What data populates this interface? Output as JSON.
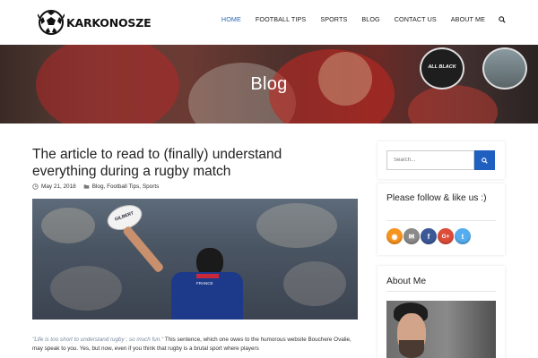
{
  "header": {
    "logo_text": "KARKONOSZE",
    "nav": [
      {
        "label": "HOME",
        "active": true
      },
      {
        "label": "FOOTBALL TIPS",
        "active": false
      },
      {
        "label": "SPORTS",
        "active": false
      },
      {
        "label": "BLOG",
        "active": false
      },
      {
        "label": "CONTACT US",
        "active": false
      },
      {
        "label": "ABOUT ME",
        "active": false
      }
    ],
    "search_icon": "search-icon"
  },
  "hero": {
    "title": "Blog",
    "badge_left_text": "ALL BLACK"
  },
  "post": {
    "title": "The article to read to (finally) understand everything during a rugby match",
    "date": "May 21, 2018",
    "categories": "Blog, Football Tips, Sports",
    "image_text": "GILBERT",
    "jersey_text": "FRANCE",
    "excerpt_quote": "\"Life is too short to understand rugby ; so much fun.\"",
    "excerpt_body": " This sentence, which one owes to the humorous website Bouchere Ovalie, may speak to you. Yes, but now, even if you think that rugby is a brutal sport where players"
  },
  "sidebar": {
    "search_placeholder": "Search...",
    "follow_title": "Please follow & like us :)",
    "social": [
      {
        "name": "rss-icon",
        "glyph": "◉",
        "color": "#f7941d"
      },
      {
        "name": "email-icon",
        "glyph": "✉",
        "color": "#8a8a8a"
      },
      {
        "name": "facebook-icon",
        "glyph": "f",
        "color": "#3b5998"
      },
      {
        "name": "google-plus-icon",
        "glyph": "G+",
        "color": "#dd4b39"
      },
      {
        "name": "twitter-icon",
        "glyph": "t",
        "color": "#55acee"
      }
    ],
    "about_title": "About Me"
  },
  "colors": {
    "accent": "#2a68b8",
    "search_button": "#1f5fbf"
  }
}
